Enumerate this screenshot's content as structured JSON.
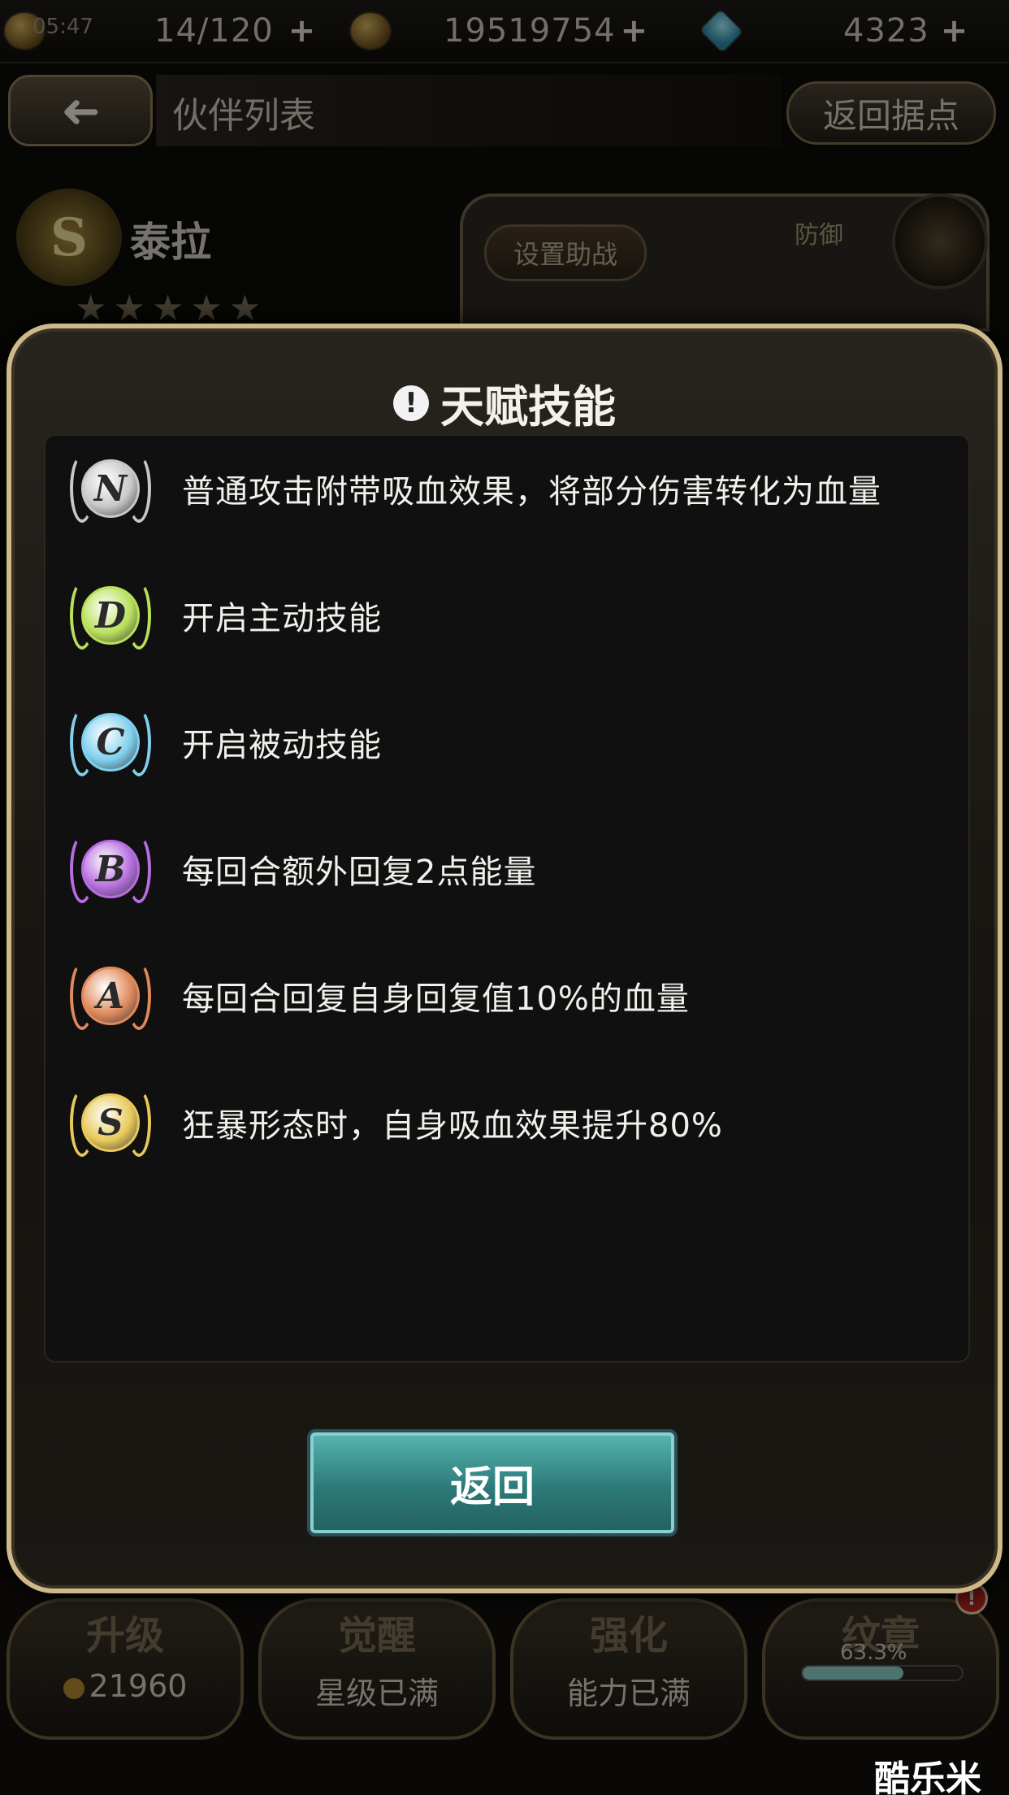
{
  "status_bar": {
    "time": "05:47",
    "stamina": "14/120",
    "gold": "19519754",
    "gems": "4323",
    "plus": "+"
  },
  "header": {
    "back_glyph": "➜",
    "title": "伙伴列表",
    "home_button": "返回据点"
  },
  "character": {
    "rank": "S",
    "name": "泰拉",
    "stars": "★★★★★",
    "assist_button": "设置助战",
    "role": "防御"
  },
  "modal": {
    "info_glyph": "!",
    "title": "天赋技能",
    "skills": [
      {
        "rank": "N",
        "text": "普通攻击附带吸血效果，将部分伤害转化为血量",
        "color": "#c8c8c8"
      },
      {
        "rank": "D",
        "text": "开启主动技能",
        "color": "#b8e05a"
      },
      {
        "rank": "C",
        "text": "开启被动技能",
        "color": "#7fd0ee"
      },
      {
        "rank": "B",
        "text": "每回合额外回复2点能量",
        "color": "#b66ee0"
      },
      {
        "rank": "A",
        "text": "每回合回复自身回复值10%的血量",
        "color": "#e08a5c"
      },
      {
        "rank": "S",
        "text": "狂暴形态时，自身吸血效果提升80%",
        "color": "#e7c95a"
      }
    ],
    "return_button": "返回"
  },
  "bottom_nav": [
    {
      "label": "升级",
      "sub": "21960",
      "has_coin": true
    },
    {
      "label": "觉醒",
      "sub": "星级已满"
    },
    {
      "label": "强化",
      "sub": "能力已满"
    },
    {
      "label": "纹章",
      "sub": ""
    }
  ],
  "emblem": {
    "progress_text": "63.3%",
    "progress": 0.633,
    "badge": "!"
  },
  "watermark": "酷乐米"
}
